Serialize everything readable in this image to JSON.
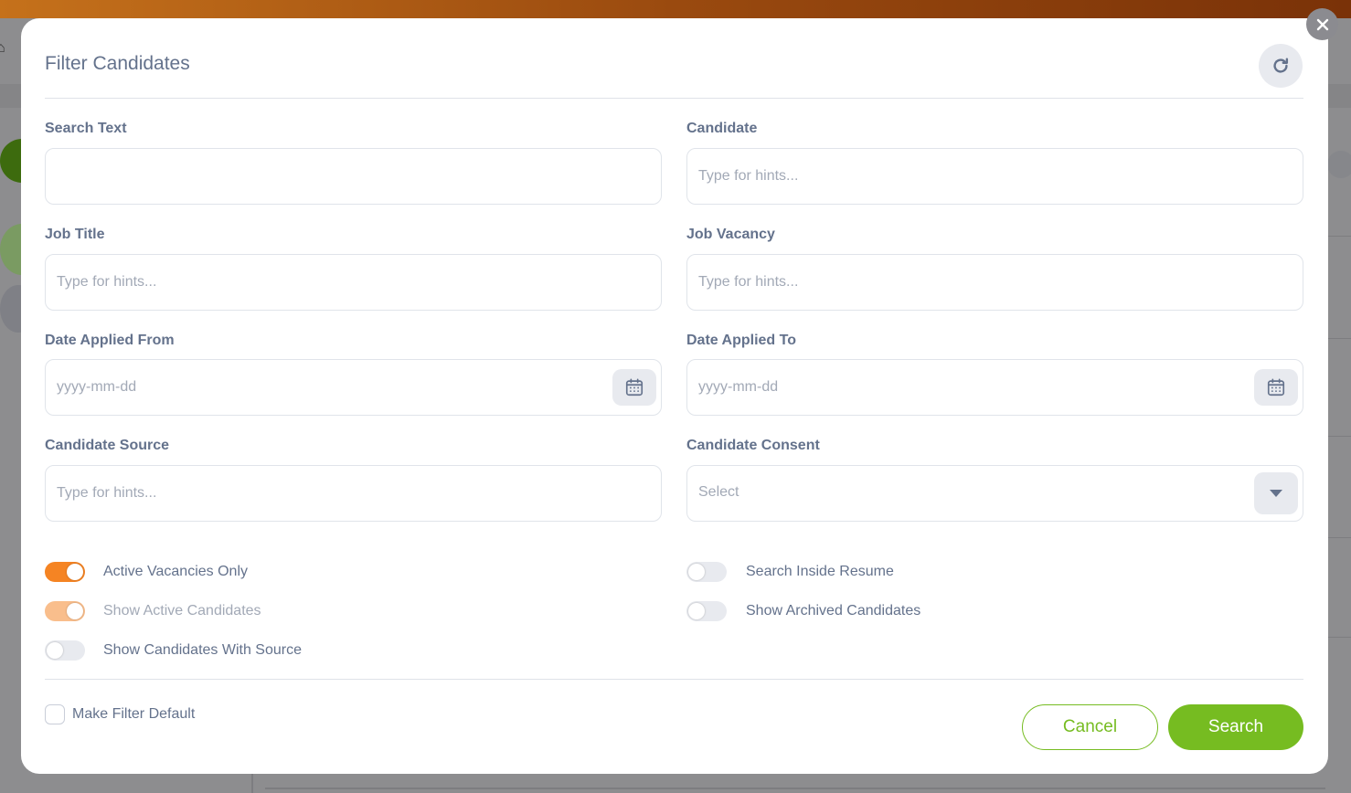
{
  "modal": {
    "title": "Filter Candidates",
    "close_icon": "close-icon",
    "reset_icon": "refresh-icon"
  },
  "fields": {
    "search_text": {
      "label": "Search Text",
      "value": "",
      "placeholder": ""
    },
    "candidate": {
      "label": "Candidate",
      "placeholder": "Type for hints..."
    },
    "job_title": {
      "label": "Job Title",
      "placeholder": "Type for hints..."
    },
    "job_vacancy": {
      "label": "Job Vacancy",
      "placeholder": "Type for hints..."
    },
    "date_from": {
      "label": "Date Applied From",
      "placeholder": "yyyy-mm-dd",
      "icon": "calendar-icon"
    },
    "date_to": {
      "label": "Date Applied To",
      "placeholder": "yyyy-mm-dd",
      "icon": "calendar-icon"
    },
    "candidate_source": {
      "label": "Candidate Source",
      "placeholder": "Type for hints..."
    },
    "candidate_consent": {
      "label": "Candidate Consent",
      "selected": "Select",
      "icon": "caret-down-icon"
    }
  },
  "toggles": {
    "active_vacancies": {
      "label": "Active Vacancies Only",
      "state": "on"
    },
    "show_active_candidates": {
      "label": "Show Active Candidates",
      "state": "on-disabled"
    },
    "show_candidates_with_source": {
      "label": "Show Candidates With Source",
      "state": "off"
    },
    "search_inside_resume": {
      "label": "Search Inside Resume",
      "state": "off"
    },
    "show_archived_candidates": {
      "label": "Show Archived Candidates",
      "state": "off"
    }
  },
  "footer": {
    "make_default_label": "Make Filter Default",
    "make_default_checked": false,
    "cancel_label": "Cancel",
    "search_label": "Search"
  },
  "colors": {
    "accent_green": "#76bc21",
    "toggle_orange": "#f58423",
    "text_slate": "#64728c"
  }
}
